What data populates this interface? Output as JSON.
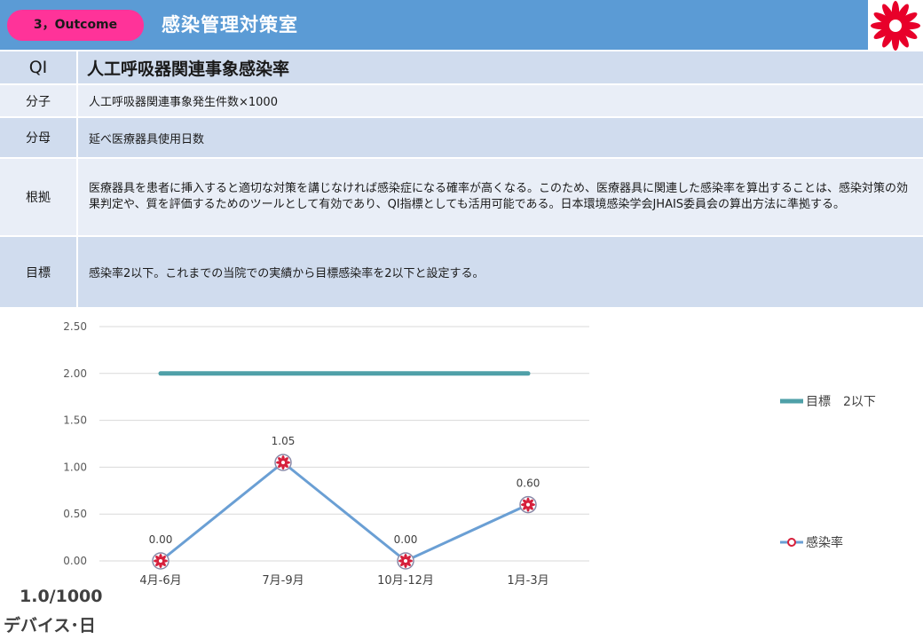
{
  "header": {
    "badge": "3，Outcome",
    "department": "感染管理対策室",
    "bg_color": "#5b9bd5",
    "badge_color": "#ff3399"
  },
  "logo": {
    "icon": "hospital-emblem-icon",
    "color": "#e8002a"
  },
  "table": {
    "qi": {
      "label": "QI",
      "value": "人工呼吸器関連事象感染率"
    },
    "numerator": {
      "label": "分子",
      "value": "人工呼吸器関連事象発生件数×1000"
    },
    "denominator": {
      "label": "分母",
      "value": "延べ医療器具使用日数"
    },
    "basis": {
      "label": "根拠",
      "value": "医療器具を患者に挿入すると適切な対策を講じなければ感染症になる確率が高くなる。このため、医療器具に関連した感染率を算出することは、感染対策の効果判定や、質を評価するためのツールとして有効であり、QI指標としても活用可能である。日本環境感染学会JHAIS委員会の算出方法に準拠する。"
    },
    "goal": {
      "label": "目標",
      "value": "感染率2以下。これまでの当院での実績から目標感染率を2以下と設定する。"
    }
  },
  "chart_data": {
    "type": "line",
    "categories": [
      "4月-6月",
      "7月-9月",
      "10月-12月",
      "1月-3月"
    ],
    "series": [
      {
        "name": "目標　2以下",
        "values": [
          2.0,
          2.0,
          2.0,
          2.0
        ],
        "color": "#4fa0a8",
        "markers": false,
        "data_labels": false
      },
      {
        "name": "感染率",
        "values": [
          0.0,
          1.05,
          0.0,
          0.6
        ],
        "color": "#6a9fd4",
        "markers": true,
        "data_labels": true
      }
    ],
    "y_ticks": [
      "0.00",
      "0.50",
      "1.00",
      "1.50",
      "2.00",
      "2.50"
    ],
    "data_labels": [
      "0.00",
      "1.05",
      "0.00",
      "0.60"
    ],
    "ylim": [
      0,
      2.5
    ],
    "grid": true,
    "legend": "right"
  },
  "unit": {
    "line1": "1.0/1000",
    "line2": "デバイス･日"
  }
}
